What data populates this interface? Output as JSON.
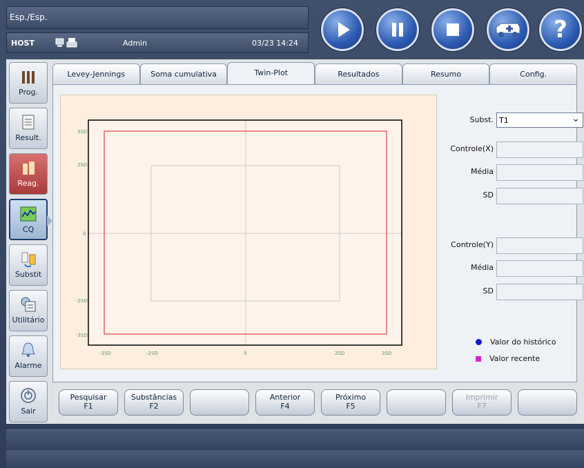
{
  "header": {
    "title": "Esp./Esp.",
    "host": "HOST",
    "user": "Admin",
    "datetime": "03/23 14:24"
  },
  "controls": [
    {
      "name": "play-button",
      "icon": "play-icon"
    },
    {
      "name": "pause-button",
      "icon": "pause-icon"
    },
    {
      "name": "stop-button",
      "icon": "stop-icon"
    },
    {
      "name": "ambulance-button",
      "icon": "ambulance-icon"
    },
    {
      "name": "help-button",
      "icon": "help-icon",
      "glyph": "?"
    }
  ],
  "sidebar": {
    "items": [
      {
        "label": "Prog.",
        "icon": "program-icon"
      },
      {
        "label": "Result.",
        "icon": "results-icon"
      },
      {
        "label": "Reag.",
        "icon": "reagent-icon"
      },
      {
        "label": "CQ",
        "icon": "qc-chart-icon"
      },
      {
        "label": "Substit",
        "icon": "substitution-icon"
      },
      {
        "label": "Utilitário",
        "icon": "utility-icon"
      },
      {
        "label": "Alarme",
        "icon": "bell-icon"
      },
      {
        "label": "Sair",
        "icon": "power-icon"
      }
    ]
  },
  "tabs": [
    "Levey-Jennings",
    "Soma cumulativa",
    "Twin-Plot",
    "Resultados",
    "Resumo",
    "Config."
  ],
  "active_tab": "Twin-Plot",
  "plot": {
    "y_labels": [
      "3SD",
      "2SD",
      "X̄",
      "-2SD",
      "-3SD"
    ],
    "x_labels": [
      "-3SD",
      "-2SD",
      "X̄",
      "2SD",
      "3SD"
    ]
  },
  "form": {
    "subst_label": "Subst.",
    "subst_value": "T1",
    "controle_x_label": "Controle(X)",
    "media_label_x": "Média",
    "sd_label_x": "SD",
    "controle_y_label": "Controle(Y)",
    "media_label_y": "Média",
    "sd_label_y": "SD"
  },
  "legend": {
    "historico": "Valor do histórico",
    "recente": "Valor recente"
  },
  "fkeys": [
    {
      "label": "Pesquisar",
      "key": "F1"
    },
    {
      "label": "Substâncias",
      "key": "F2"
    },
    {
      "label": "",
      "key": ""
    },
    {
      "label": "Anterior",
      "key": "F4"
    },
    {
      "label": "Próximo",
      "key": "F5"
    },
    {
      "label": "",
      "key": ""
    },
    {
      "label": "Imprimir",
      "key": "F7"
    },
    {
      "label": "",
      "key": ""
    }
  ],
  "colors": {
    "plot_bg": "#fdeee0",
    "sd3_line": "#000000",
    "sd2_line": "#e04040",
    "historico_dot": "#1515d8",
    "recente_square": "#e020d0"
  }
}
